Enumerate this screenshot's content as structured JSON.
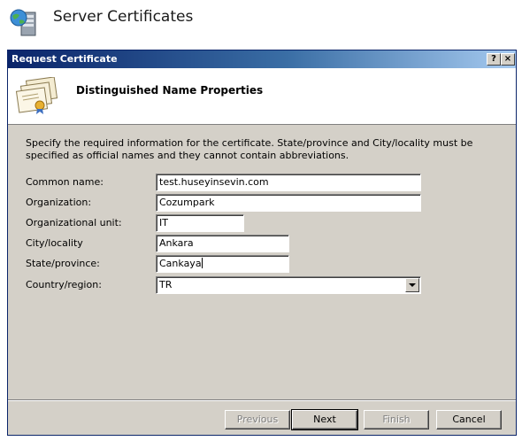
{
  "page": {
    "title": "Server Certificates"
  },
  "dialog": {
    "title": "Request Certificate",
    "help_button": "?",
    "close_button": "×",
    "heading": "Distinguished Name Properties",
    "instructions": "Specify the required information for the certificate. State/province and City/locality must be specified as official names and they cannot contain abbreviations."
  },
  "form": {
    "fields": [
      {
        "label": "Common name:",
        "value": "test.huseyinsevin.com"
      },
      {
        "label": "Organization:",
        "value": "Cozumpark"
      },
      {
        "label": "Organizational unit:",
        "value": "IT"
      },
      {
        "label": "City/locality",
        "value": "Ankara"
      },
      {
        "label": "State/province:",
        "value": "Cankaya"
      },
      {
        "label": "Country/region:",
        "value": "TR"
      }
    ]
  },
  "buttons": {
    "previous": "Previous",
    "next": "Next",
    "finish": "Finish",
    "cancel": "Cancel"
  },
  "icons": {
    "page_icon": "server-icon",
    "banner_icon": "certificate-icon",
    "dropdown_icon": "chevron-down-icon"
  },
  "colors": {
    "titlebar_start": "#0a246a",
    "titlebar_end": "#a6caf0",
    "dialog_face": "#d4d0c8",
    "disabled_text": "#808080"
  }
}
